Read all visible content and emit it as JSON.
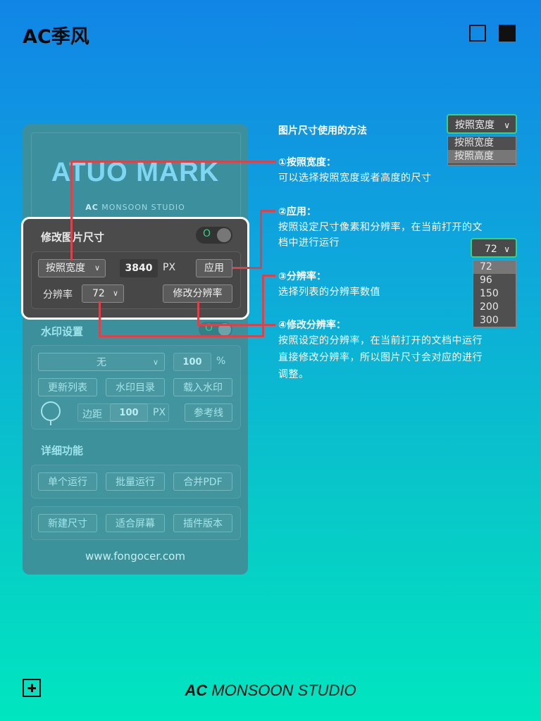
{
  "brand": {
    "title": "AC季风"
  },
  "footer": {
    "ac": "AC",
    "monsoon": "MONSOON",
    "studio": "STUDIO"
  },
  "panel": {
    "logo": "ATUO MARK",
    "logo_sub_bold": "AC",
    "logo_sub": "MONSOON STUDIO",
    "resize": {
      "title": "修改图片尺寸",
      "toggle_mark": "O",
      "mode_select": "按照宽度",
      "size_value": "3840",
      "unit": "PX",
      "apply_label": "应用",
      "resolution_label": "分辨率",
      "resolution_select": "72",
      "modify_resolution_label": "修改分辨率"
    },
    "watermark": {
      "title": "水印设置",
      "toggle_mark": "O",
      "type_select": "无",
      "opacity_value": "100",
      "opacity_unit": "%",
      "refresh_label": "更新列表",
      "folder_label": "水印目录",
      "load_label": "载入水印",
      "margin_label": "边距",
      "margin_value": "100",
      "margin_unit": "PX",
      "guide_label": "参考线"
    },
    "details": {
      "title": "详细功能",
      "single_run": "单个运行",
      "batch_run": "批量运行",
      "merge_pdf": "合并PDF",
      "new_size": "新建尺寸",
      "fit_screen": "适合屏幕",
      "plugin_version": "插件版本"
    },
    "url": "www.fongocer.com"
  },
  "guide": {
    "heading": "图片尺寸使用的方法",
    "mode_demo": {
      "selected": "按照宽度",
      "options": [
        "按照宽度",
        "按照高度"
      ]
    },
    "res_demo": {
      "selected": "72",
      "options": [
        "72",
        "96",
        "150",
        "200",
        "300"
      ]
    },
    "items": [
      {
        "title": "①按照宽度：",
        "desc": [
          "可以选择按照宽度或者高度的尺寸"
        ]
      },
      {
        "title": "②应用：",
        "desc": [
          "按照设定尺寸像素和分辨率，在当前打开的文",
          "档中进行运行"
        ]
      },
      {
        "title": "③分辨率：",
        "desc": [
          "选择列表的分辨率数值"
        ]
      },
      {
        "title": "④修改分辨率：",
        "desc": [
          "按照设定的分辨率，在当前打开的文档中运行",
          "直接修改分辨率，所以图片尺寸会对应的进行",
          "调整。"
        ]
      }
    ]
  },
  "colors": {
    "accent_red": "#d9434b",
    "toggle_green": "#2fd28a",
    "highlight_border": "#ffffff"
  }
}
